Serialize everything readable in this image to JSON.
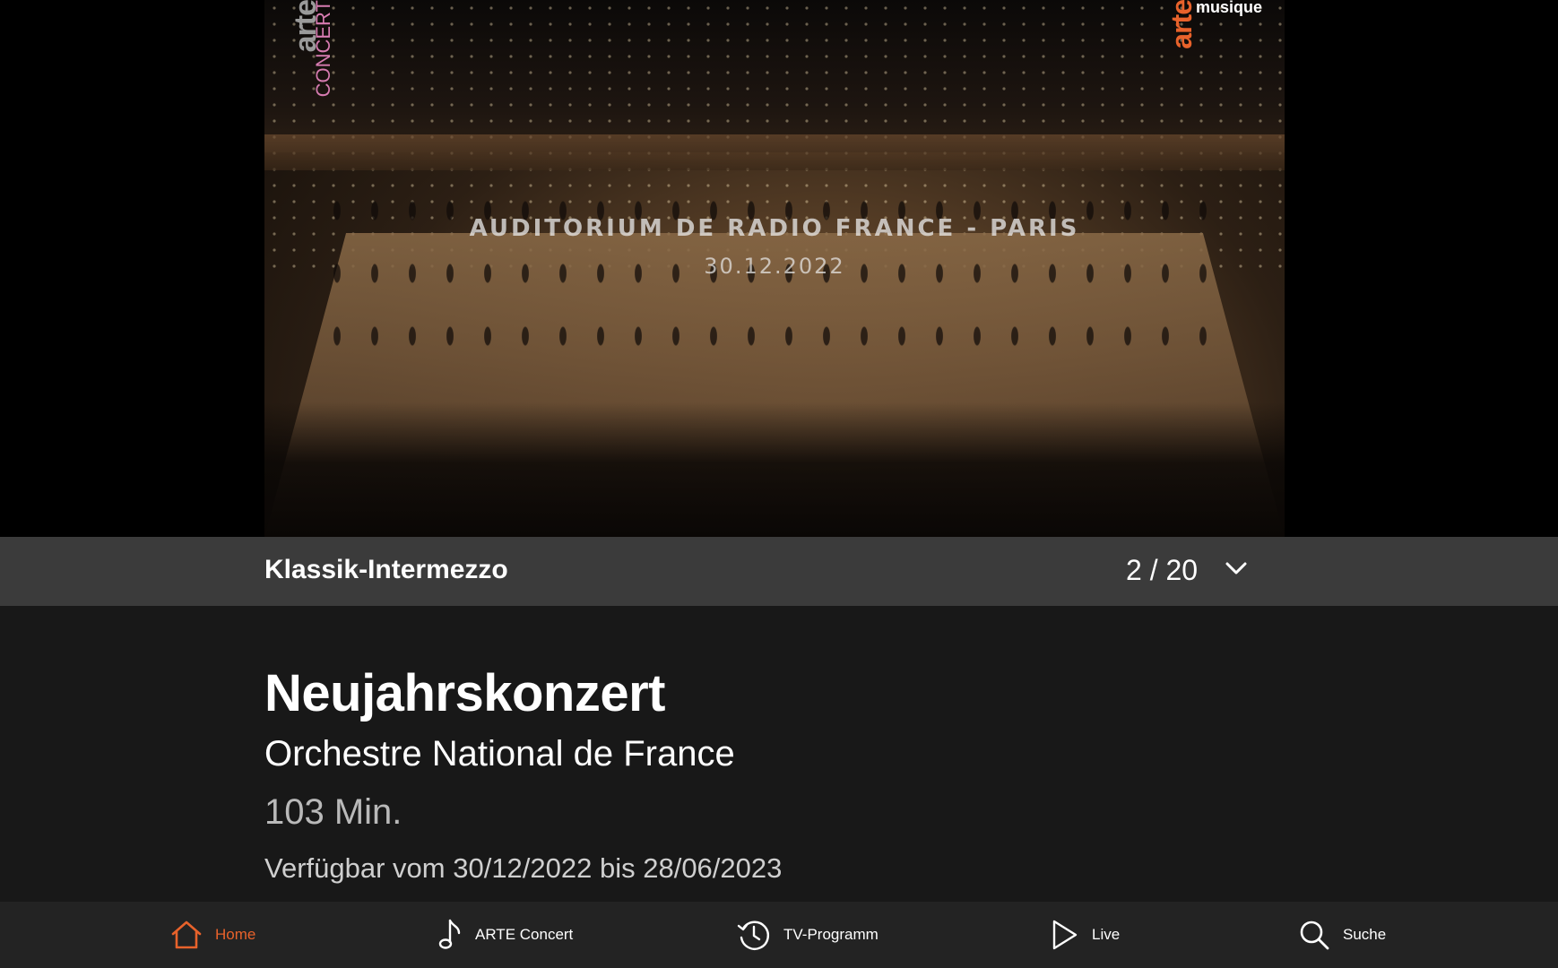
{
  "video": {
    "overlay_title": "AUDITORIUM DE RADIO FRANCE - PARIS",
    "overlay_date": "30.12.2022",
    "logo_left": {
      "brand": "arte",
      "sub": "CONCERT"
    },
    "logo_right": {
      "brand": "arte",
      "sub": "musique"
    }
  },
  "playlist": {
    "name": "Klassik-Intermezzo",
    "position": "2 / 20",
    "toggle_icon": "chevron-down-icon"
  },
  "detail": {
    "title": "Neujahrskonzert",
    "subtitle": "Orchestre National de France",
    "duration": "103 Min.",
    "availability": "Verfügbar vom 30/12/2022 bis 28/06/2023"
  },
  "nav": {
    "items": [
      {
        "label": "Home",
        "icon": "home-icon",
        "active": true
      },
      {
        "label": "ARTE Concert",
        "icon": "music-note-icon",
        "active": false
      },
      {
        "label": "TV-Programm",
        "icon": "history-clock-icon",
        "active": false
      },
      {
        "label": "Live",
        "icon": "play-icon",
        "active": false
      },
      {
        "label": "Suche",
        "icon": "search-icon",
        "active": false
      }
    ]
  },
  "colors": {
    "accent": "#e8622b",
    "background": "#181818",
    "playlist_bar": "#3b3b3b",
    "nav_bar": "#232323"
  }
}
